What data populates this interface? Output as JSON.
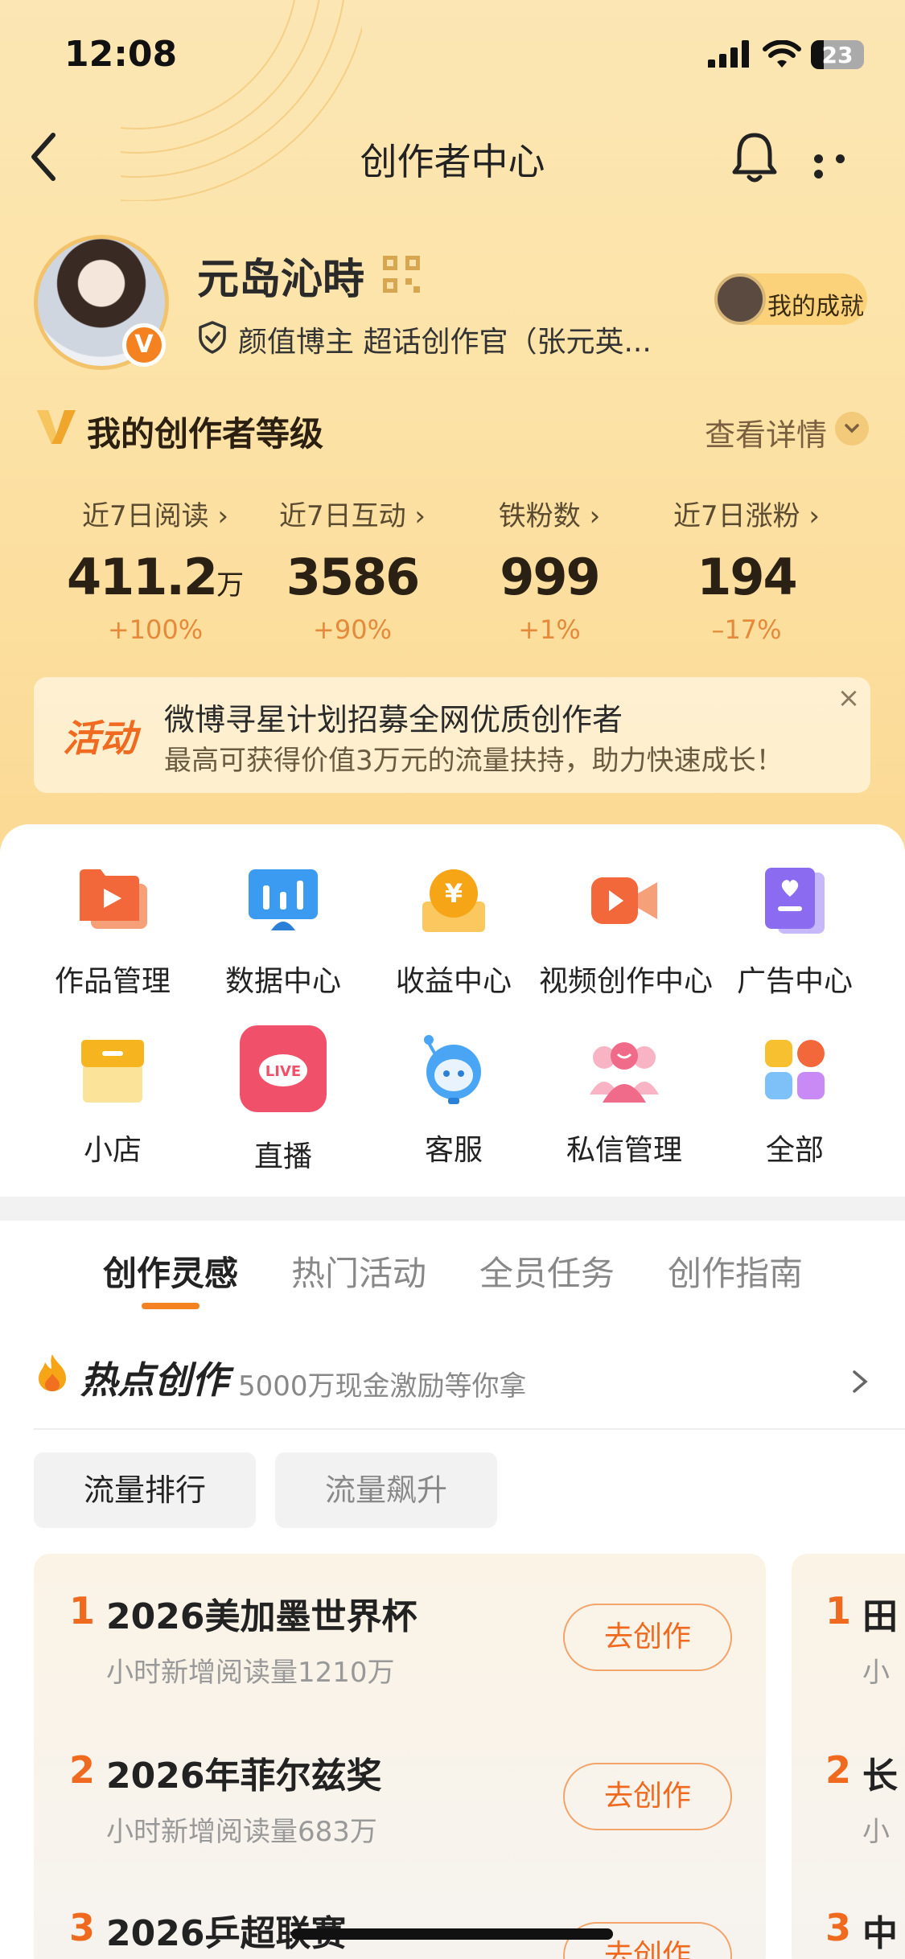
{
  "status": {
    "time": "12:08",
    "battery": "23"
  },
  "nav": {
    "title": "创作者中心"
  },
  "profile": {
    "name": "元岛沁時",
    "tags": "颜值博主 超话创作官（张元英...",
    "achievement": "我的成就"
  },
  "level": {
    "title": "我的创作者等级",
    "detail": "查看详情"
  },
  "stats": [
    {
      "label": "近7日阅读 ›",
      "value": "411.2",
      "unit": "万",
      "delta": "+100%"
    },
    {
      "label": "近7日互动 ›",
      "value": "3586",
      "unit": "",
      "delta": "+90%"
    },
    {
      "label": "铁粉数 ›",
      "value": "999",
      "unit": "",
      "delta": "+1%"
    },
    {
      "label": "近7日涨粉 ›",
      "value": "194",
      "unit": "",
      "delta": "–17%"
    }
  ],
  "activity": {
    "tag": "活动",
    "line1": "微博寻星计划招募全网优质创作者",
    "line2": "最高可获得价值3万元的流量扶持，助力快速成长！",
    "close": "×"
  },
  "tools": [
    {
      "label": "作品管理",
      "icon": "folder-play-icon",
      "color": "#f2683a"
    },
    {
      "label": "数据中心",
      "icon": "bar-chart-icon",
      "color": "#3b9bf0"
    },
    {
      "label": "收益中心",
      "icon": "yen-coin-icon",
      "color": "#f6a516"
    },
    {
      "label": "视频创作中心",
      "icon": "video-camera-icon",
      "color": "#f2683a"
    },
    {
      "label": "广告中心",
      "icon": "ad-book-icon",
      "color": "#8b6cf0"
    },
    {
      "label": "小店",
      "icon": "shop-icon",
      "color": "#f6b51e"
    },
    {
      "label": "直播",
      "icon": "live-icon",
      "color": "#f0506a"
    },
    {
      "label": "客服",
      "icon": "service-robot-icon",
      "color": "#4aa6f5"
    },
    {
      "label": "私信管理",
      "icon": "message-people-icon",
      "color": "#f06a8a"
    },
    {
      "label": "全部",
      "icon": "all-grid-icon",
      "color": "#f6c030"
    }
  ],
  "tabs": [
    "创作灵感",
    "热门活动",
    "全员任务",
    "创作指南"
  ],
  "hot": {
    "title": "热点创作",
    "subtitle": "5000万现金激励等你拿"
  },
  "chips": [
    "流量排行",
    "流量飙升"
  ],
  "ranks": [
    {
      "rank": "1",
      "title": "2026美加墨世界杯",
      "sub": "小时新增阅读量1210万",
      "btn": "去创作"
    },
    {
      "rank": "2",
      "title": "2026年菲尔兹奖",
      "sub": "小时新增阅读量683万",
      "btn": "去创作"
    },
    {
      "rank": "3",
      "title": "2026乒超联赛",
      "sub": "",
      "btn": "去创作"
    }
  ],
  "ranks2": [
    {
      "rank": "1",
      "title": "田",
      "sub": "小"
    },
    {
      "rank": "2",
      "title": "长",
      "sub": "小"
    },
    {
      "rank": "3",
      "title": "中",
      "sub": ""
    }
  ]
}
